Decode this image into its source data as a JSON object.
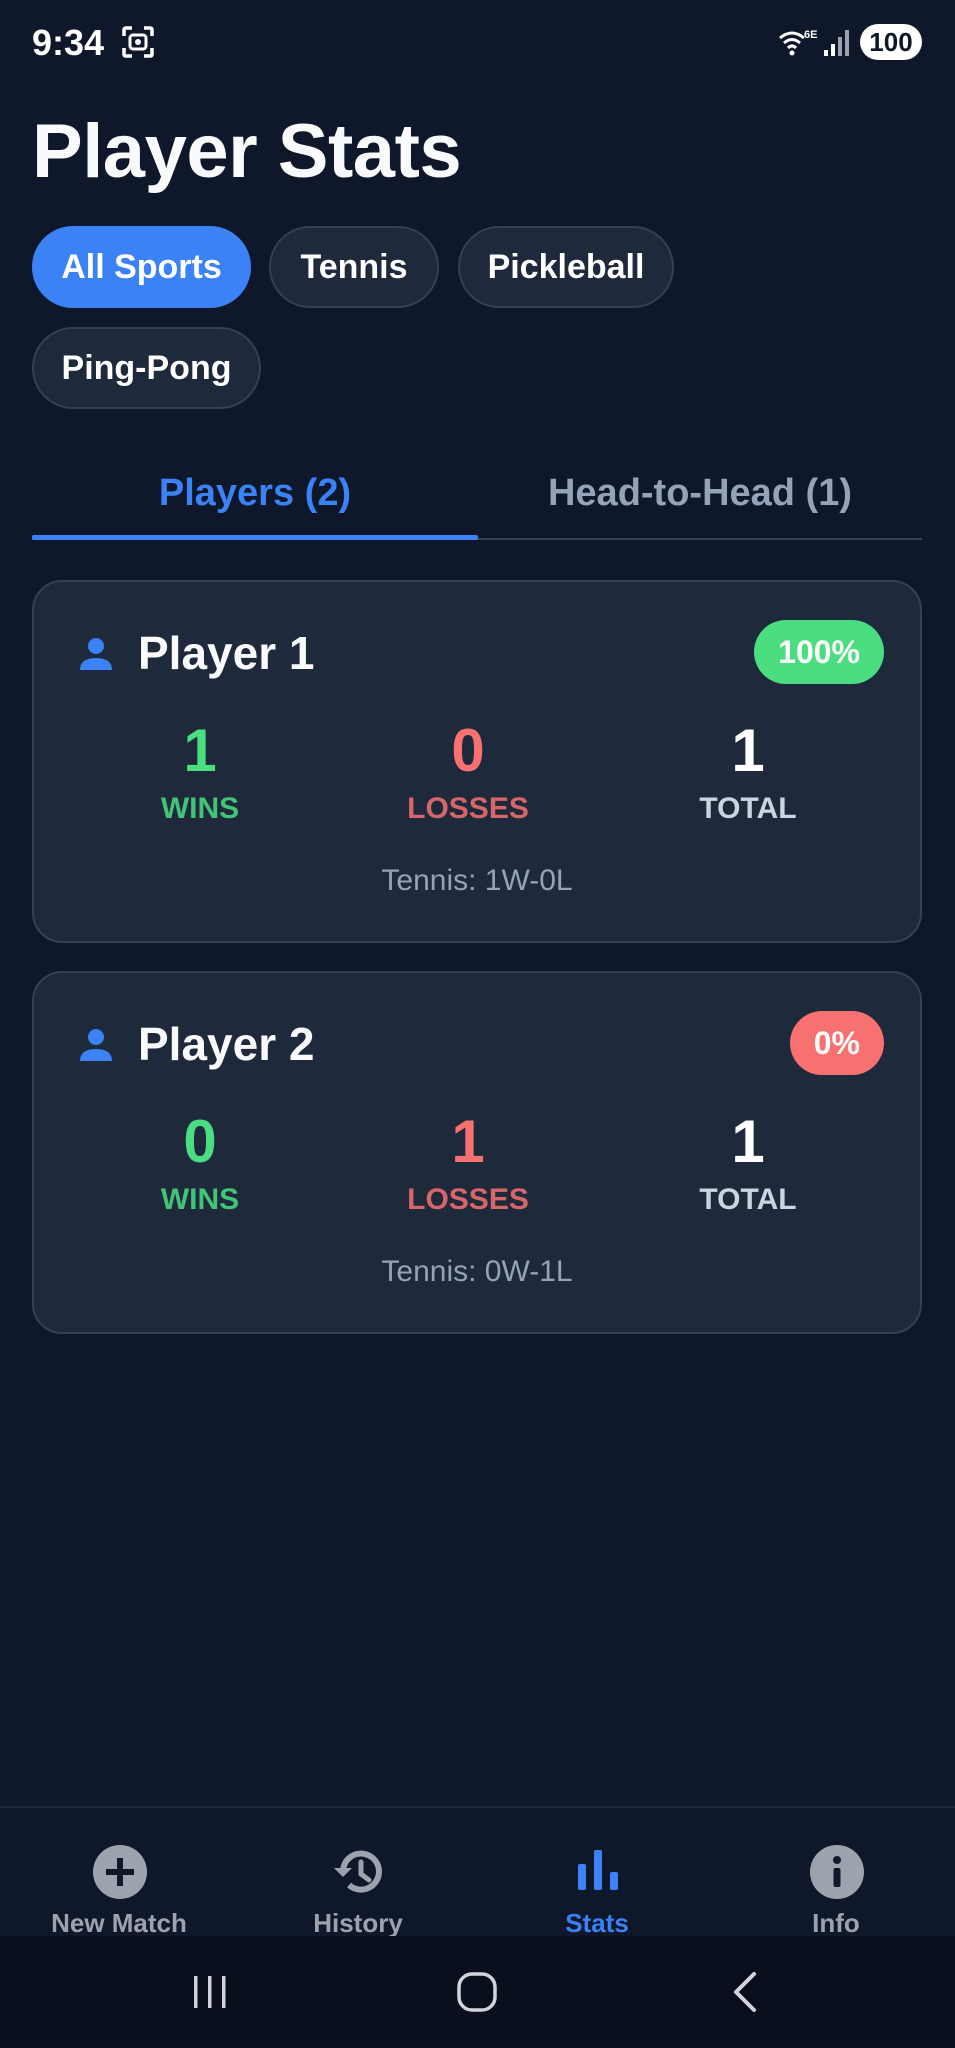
{
  "status_bar": {
    "time": "9:34",
    "battery": "100",
    "network": "6E",
    "icons": [
      "screenshot-icon",
      "wifi-icon",
      "signal-icon",
      "battery-icon"
    ]
  },
  "page": {
    "title": "Player Stats"
  },
  "filters": [
    {
      "label": "All Sports",
      "active": true
    },
    {
      "label": "Tennis",
      "active": false
    },
    {
      "label": "Pickleball",
      "active": false
    },
    {
      "label": "Ping-Pong",
      "active": false
    }
  ],
  "tabs": [
    {
      "label": "Players (2)",
      "active": true
    },
    {
      "label": "Head-to-Head (1)",
      "active": false
    }
  ],
  "players": [
    {
      "name": "Player 1",
      "win_pct": "100%",
      "badge_color": "#4ade80",
      "wins": "1",
      "losses": "0",
      "total": "1",
      "wins_label": "WINS",
      "losses_label": "LOSSES",
      "total_label": "TOTAL",
      "sport_line": "Tennis: 1W-0L"
    },
    {
      "name": "Player 2",
      "win_pct": "0%",
      "badge_color": "#f87171",
      "wins": "0",
      "losses": "1",
      "total": "1",
      "wins_label": "WINS",
      "losses_label": "LOSSES",
      "total_label": "TOTAL",
      "sport_line": "Tennis: 0W-1L"
    }
  ],
  "bottom_nav": [
    {
      "label": "New Match",
      "icon": "add-circle-icon",
      "active": false
    },
    {
      "label": "History",
      "icon": "history-icon",
      "active": false
    },
    {
      "label": "Stats",
      "icon": "bar-chart-icon",
      "active": true
    },
    {
      "label": "Info",
      "icon": "info-icon",
      "active": false
    }
  ],
  "colors": {
    "background": "#0f172a",
    "card": "#1e293b",
    "accent": "#3b82f6",
    "win": "#4ade80",
    "loss": "#f87171"
  }
}
